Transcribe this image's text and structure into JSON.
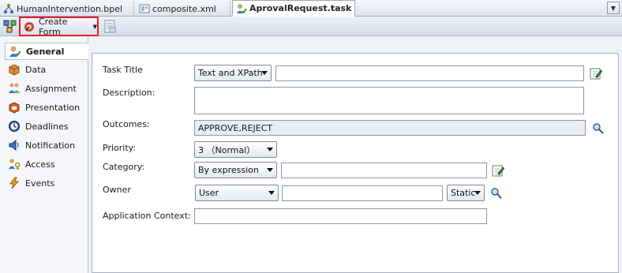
{
  "tabs": [
    {
      "label": "HumanIntervention.bpel",
      "icon": "bpel-process-icon"
    },
    {
      "label": "composite.xml",
      "icon": "composite-icon"
    },
    {
      "label": "AprovalRequest.task",
      "icon": "task-icon",
      "active": true
    }
  ],
  "toolbar": {
    "create_form_label": "Create Form",
    "create_form_icon": "form-wizard-icon"
  },
  "nav": [
    {
      "label": "General",
      "icon": "general-icon"
    },
    {
      "label": "Data",
      "icon": "data-icon"
    },
    {
      "label": "Assignment",
      "icon": "assignment-icon"
    },
    {
      "label": "Presentation",
      "icon": "presentation-icon"
    },
    {
      "label": "Deadlines",
      "icon": "deadlines-icon"
    },
    {
      "label": "Notification",
      "icon": "notification-icon"
    },
    {
      "label": "Access",
      "icon": "access-icon"
    },
    {
      "label": "Events",
      "icon": "events-icon"
    }
  ],
  "form": {
    "task_title_label": "Task Title",
    "task_title_mode": "Text and XPath",
    "task_title_value": "",
    "description_label": "Description:",
    "description_value": "",
    "outcomes_label": "Outcomes:",
    "outcomes_value": "APPROVE,REJECT",
    "priority_label": "Priority:",
    "priority_value": "3 （Normal）",
    "category_label": "Category:",
    "category_mode": "By expression",
    "category_value": "",
    "owner_label": "Owner",
    "owner_type": "User",
    "owner_value": "",
    "owner_mode": "Static",
    "app_context_label": "Application Context:",
    "app_context_value": ""
  },
  "colors": {
    "highlight_border": "#e0202a",
    "toolbar_bg": "#d9e1ec"
  }
}
